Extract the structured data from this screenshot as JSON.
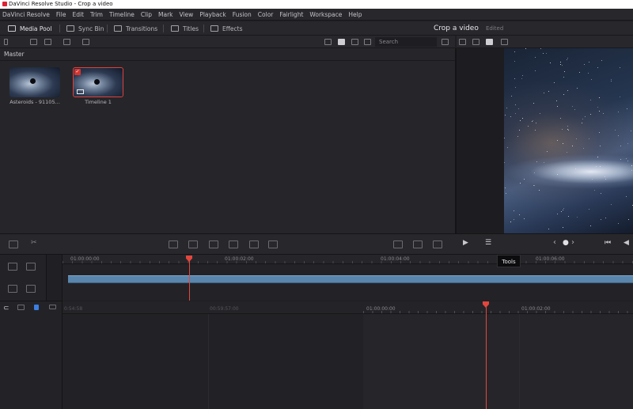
{
  "window": {
    "title": "DaVinci Resolve Studio - Crop a video"
  },
  "menu": [
    "DaVinci Resolve",
    "File",
    "Edit",
    "Trim",
    "Timeline",
    "Clip",
    "Mark",
    "View",
    "Playback",
    "Fusion",
    "Color",
    "Fairlight",
    "Workspace",
    "Help"
  ],
  "toolbar": {
    "media_pool": "Media Pool",
    "sync_bin": "Sync Bin",
    "transitions": "Transitions",
    "titles": "Titles",
    "effects": "Effects",
    "project_title": "Crop a video",
    "project_state": "Edited"
  },
  "media": {
    "search_placeholder": "Search",
    "bin_name": "Master",
    "clips": [
      {
        "label": "Asteroids - 91105..."
      },
      {
        "label": "Timeline 1"
      }
    ]
  },
  "tooltip": {
    "text": "Tools"
  },
  "timeline": {
    "upper_timecodes": [
      "01:00:00:00",
      "01:00:02:00",
      "01:00:04:00",
      "01:00:06:00"
    ],
    "lower_timecodes": [
      "0:54:58",
      "00:59:57:00",
      "01:00:00:00",
      "01:00:02:00"
    ]
  },
  "colors": {
    "accent": "#e4463d",
    "clip": "#5a86ad",
    "selection": "#e0413b"
  }
}
